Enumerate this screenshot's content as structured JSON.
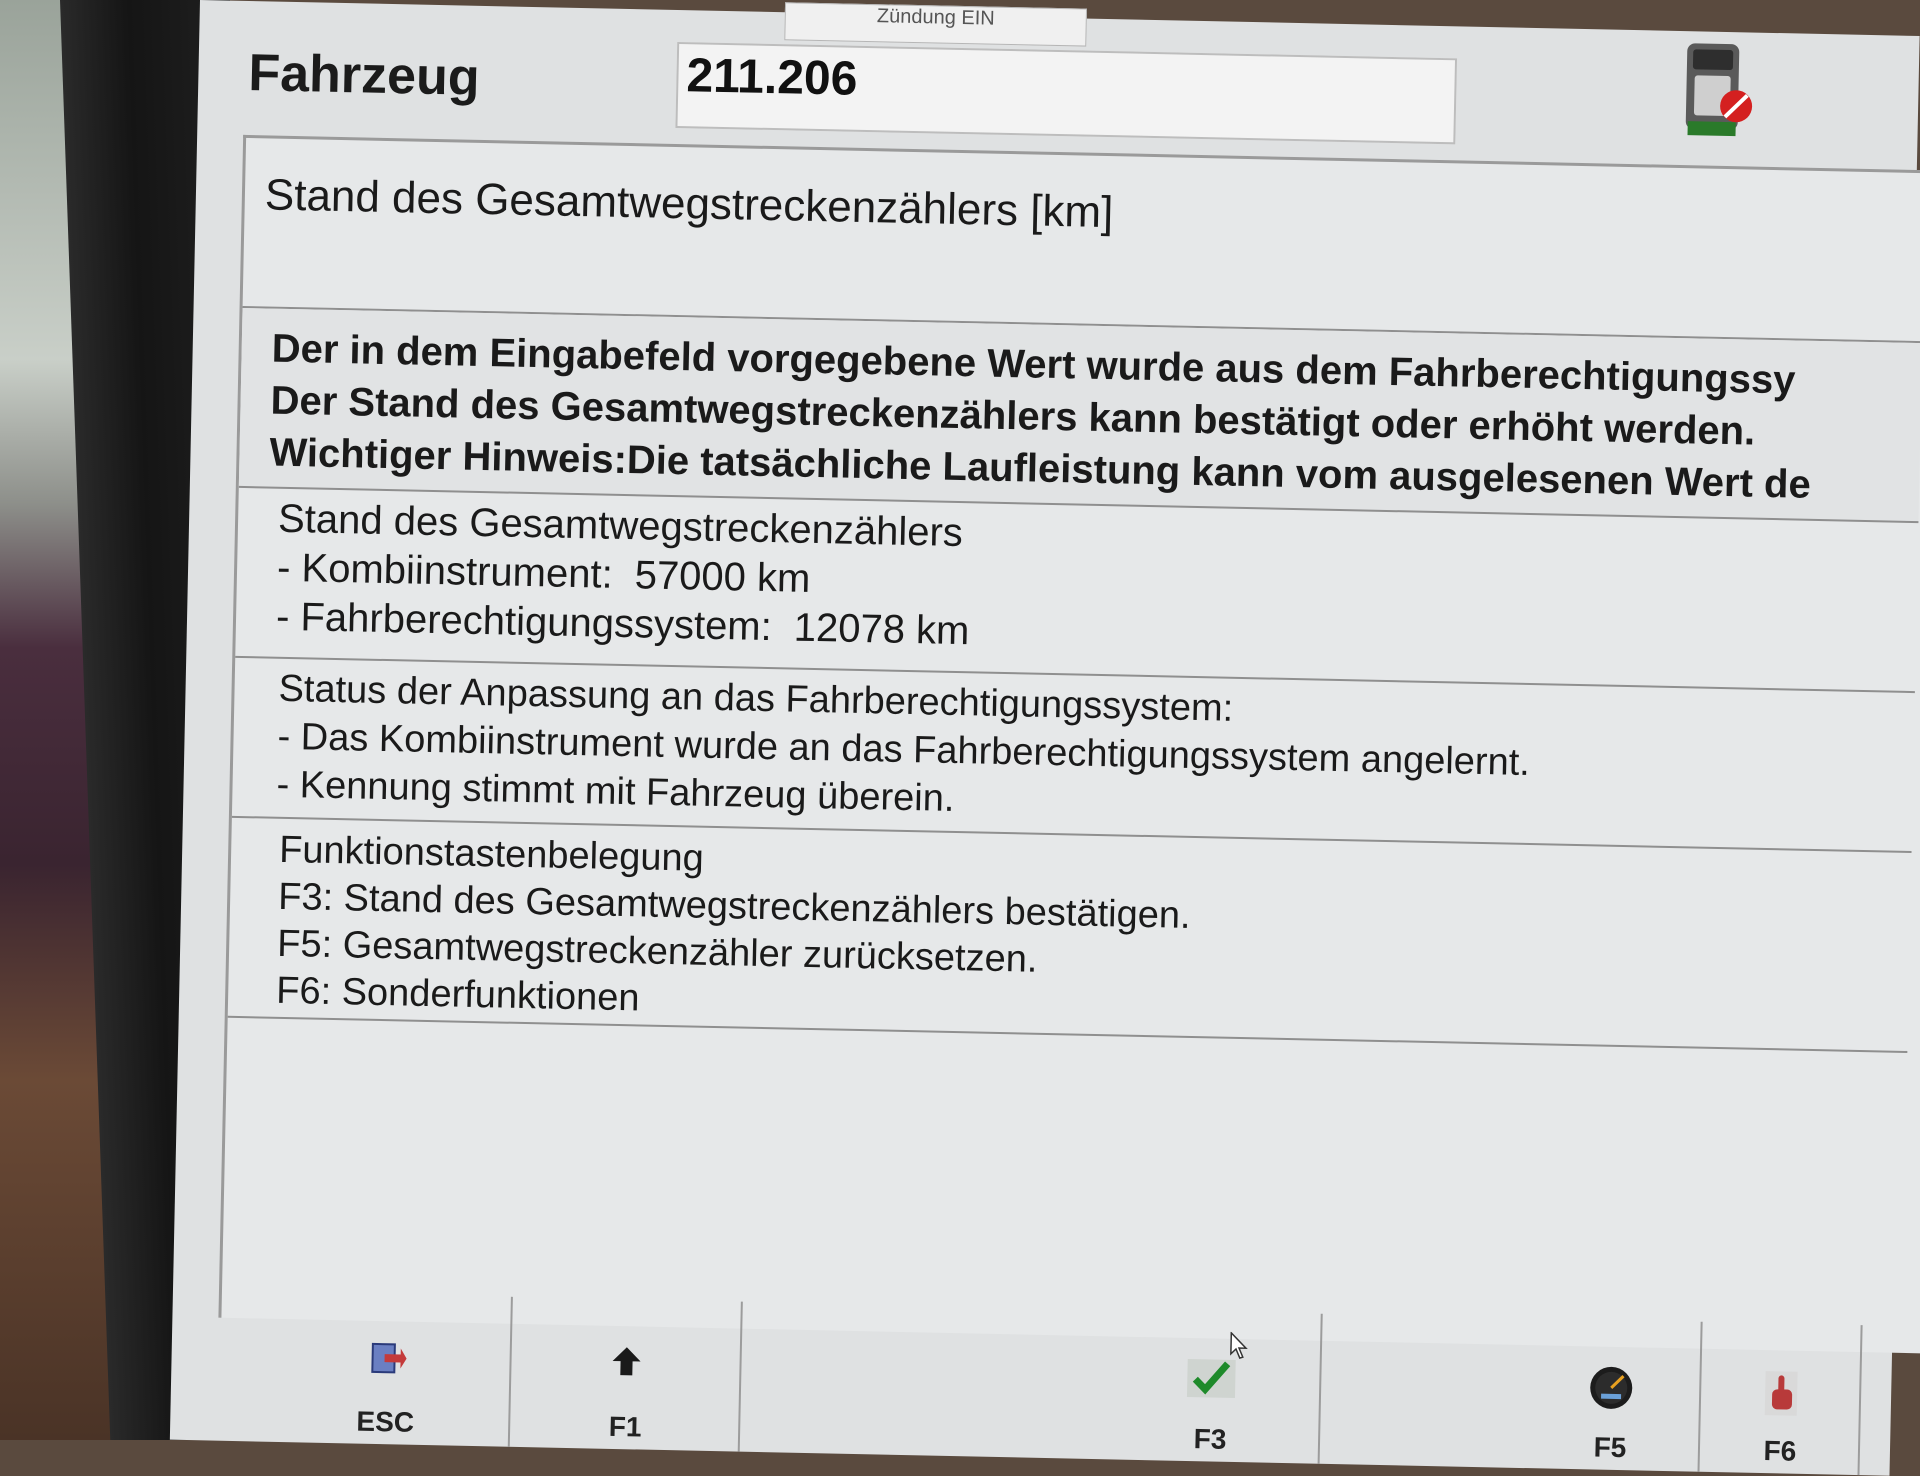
{
  "window": {
    "tab_label": "Zündung EIN",
    "vehicle_label": "Fahrzeug",
    "vehicle_value": "211.206"
  },
  "sections": {
    "title": "Stand des Gesamtwegstreckenzählers [km]",
    "warning": [
      "Der in dem Eingabefeld vorgegebene Wert wurde aus dem Fahrberechtigungssy",
      "Der Stand des Gesamtwegstreckenzählers kann bestätigt oder erhöht werden.",
      "Wichtiger Hinweis:Die tatsächliche Laufleistung kann vom ausgelesenen Wert de"
    ],
    "odometer": {
      "heading": "Stand des Gesamtwegstreckenzählers",
      "kombi_label": "- Kombiinstrument:",
      "kombi_value": "57000 km",
      "fbs_label": "- Fahrberechtigungssystem:",
      "fbs_value": "12078 km"
    },
    "status": [
      "Status der Anpassung an das Fahrberechtigungssystem:",
      "- Das Kombiinstrument wurde an das Fahrberechtigungssystem angelernt.",
      "- Kennung stimmt mit Fahrzeug überein."
    ],
    "function_keys": [
      "Funktionstastenbelegung",
      "F3: Stand des Gesamtwegstreckenzählers bestätigen.",
      "F5: Gesamtwegstreckenzähler zurücksetzen.",
      "F6: Sonderfunktionen"
    ]
  },
  "toolbar": {
    "esc": {
      "label": "ESC",
      "icon": "exit-door-icon"
    },
    "f1": {
      "label": "F1",
      "icon": "arrow-up-icon"
    },
    "f3": {
      "label": "F3",
      "icon": "checkmark-icon"
    },
    "f5": {
      "label": "F5",
      "icon": "gauge-icon"
    },
    "f6": {
      "label": "F6",
      "icon": "pointing-hand-icon"
    }
  },
  "colors": {
    "screen_bg": "#e6e8e9",
    "check_green": "#1e8a2a",
    "no_sign_red": "#d42020"
  }
}
